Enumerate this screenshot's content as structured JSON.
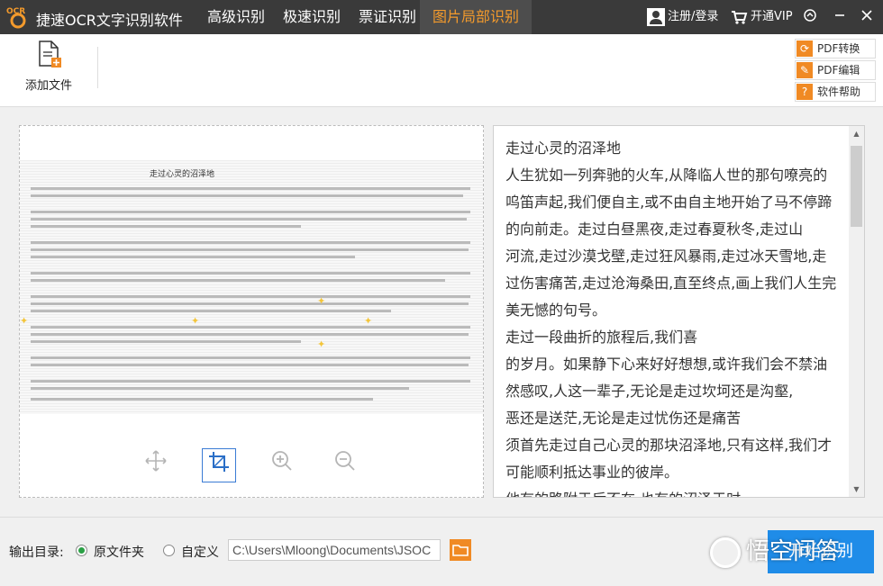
{
  "titlebar": {
    "logo_text": "OCR",
    "app_title": "捷速OCR文字识别软件",
    "tabs": [
      {
        "label": "高级识别"
      },
      {
        "label": "极速识别"
      },
      {
        "label": "票证识别"
      },
      {
        "label": "图片局部识别"
      }
    ],
    "active_tab": "图片局部识别",
    "login_label": "注册/登录",
    "vip_label": "开通VIP",
    "accent_color": "#f39a2c"
  },
  "toolbar": {
    "add_file_label": "添加文件",
    "side_buttons": [
      {
        "label": "PDF转换",
        "icon": "refresh-icon"
      },
      {
        "label": "PDF编辑",
        "icon": "pencil-icon"
      },
      {
        "label": "软件帮助",
        "icon": "help-icon"
      }
    ]
  },
  "image_panel": {
    "doc_title": "走过心灵的沼泽地",
    "tools": [
      "move-icon",
      "crop-icon",
      "zoom-in-icon",
      "zoom-out-icon"
    ]
  },
  "text_panel": {
    "lines": [
      "走过心灵的沼泽地",
      "人生犹如一列奔驰的火车,从降临人世的那句嘹亮的",
      "呜笛声起,我们便自主,或不由自主地开始了马不停蹄",
      "的向前走。走过白昼黑夜,走过春夏秋冬,走过山",
      "河流,走过沙漠戈壁,走过狂风暴雨,走过冰天雪地,走",
      "过伤害痛苦,走过沧海桑田,直至终点,画上我们人生完",
      "美无憾的句号。",
      "走过一段曲折的旅程后,我们喜",
      "的岁月。如果静下心来好好想想,或许我们会不禁油",
      "然感叹,人这一辈子,无论是走过坎坷还是沟壑,",
      "恶还是送茫,无论是走过忧伤还是痛苦",
      "须首先走过自己心灵的那块沼泽地,只有这样,我们才",
      "可能顺利抵达事业的彼岸。",
      "他有的路附于后不在,也有的沼泽于时"
    ]
  },
  "bottom_bar": {
    "output_label": "输出目录:",
    "option_original": "原文件夹",
    "option_custom": "自定义",
    "path_value": "C:\\Users\\Mloong\\Documents\\JSOC",
    "start_label": "开始识别",
    "watermark_text": "悟空问答",
    "start_color": "#1f8ce8"
  }
}
